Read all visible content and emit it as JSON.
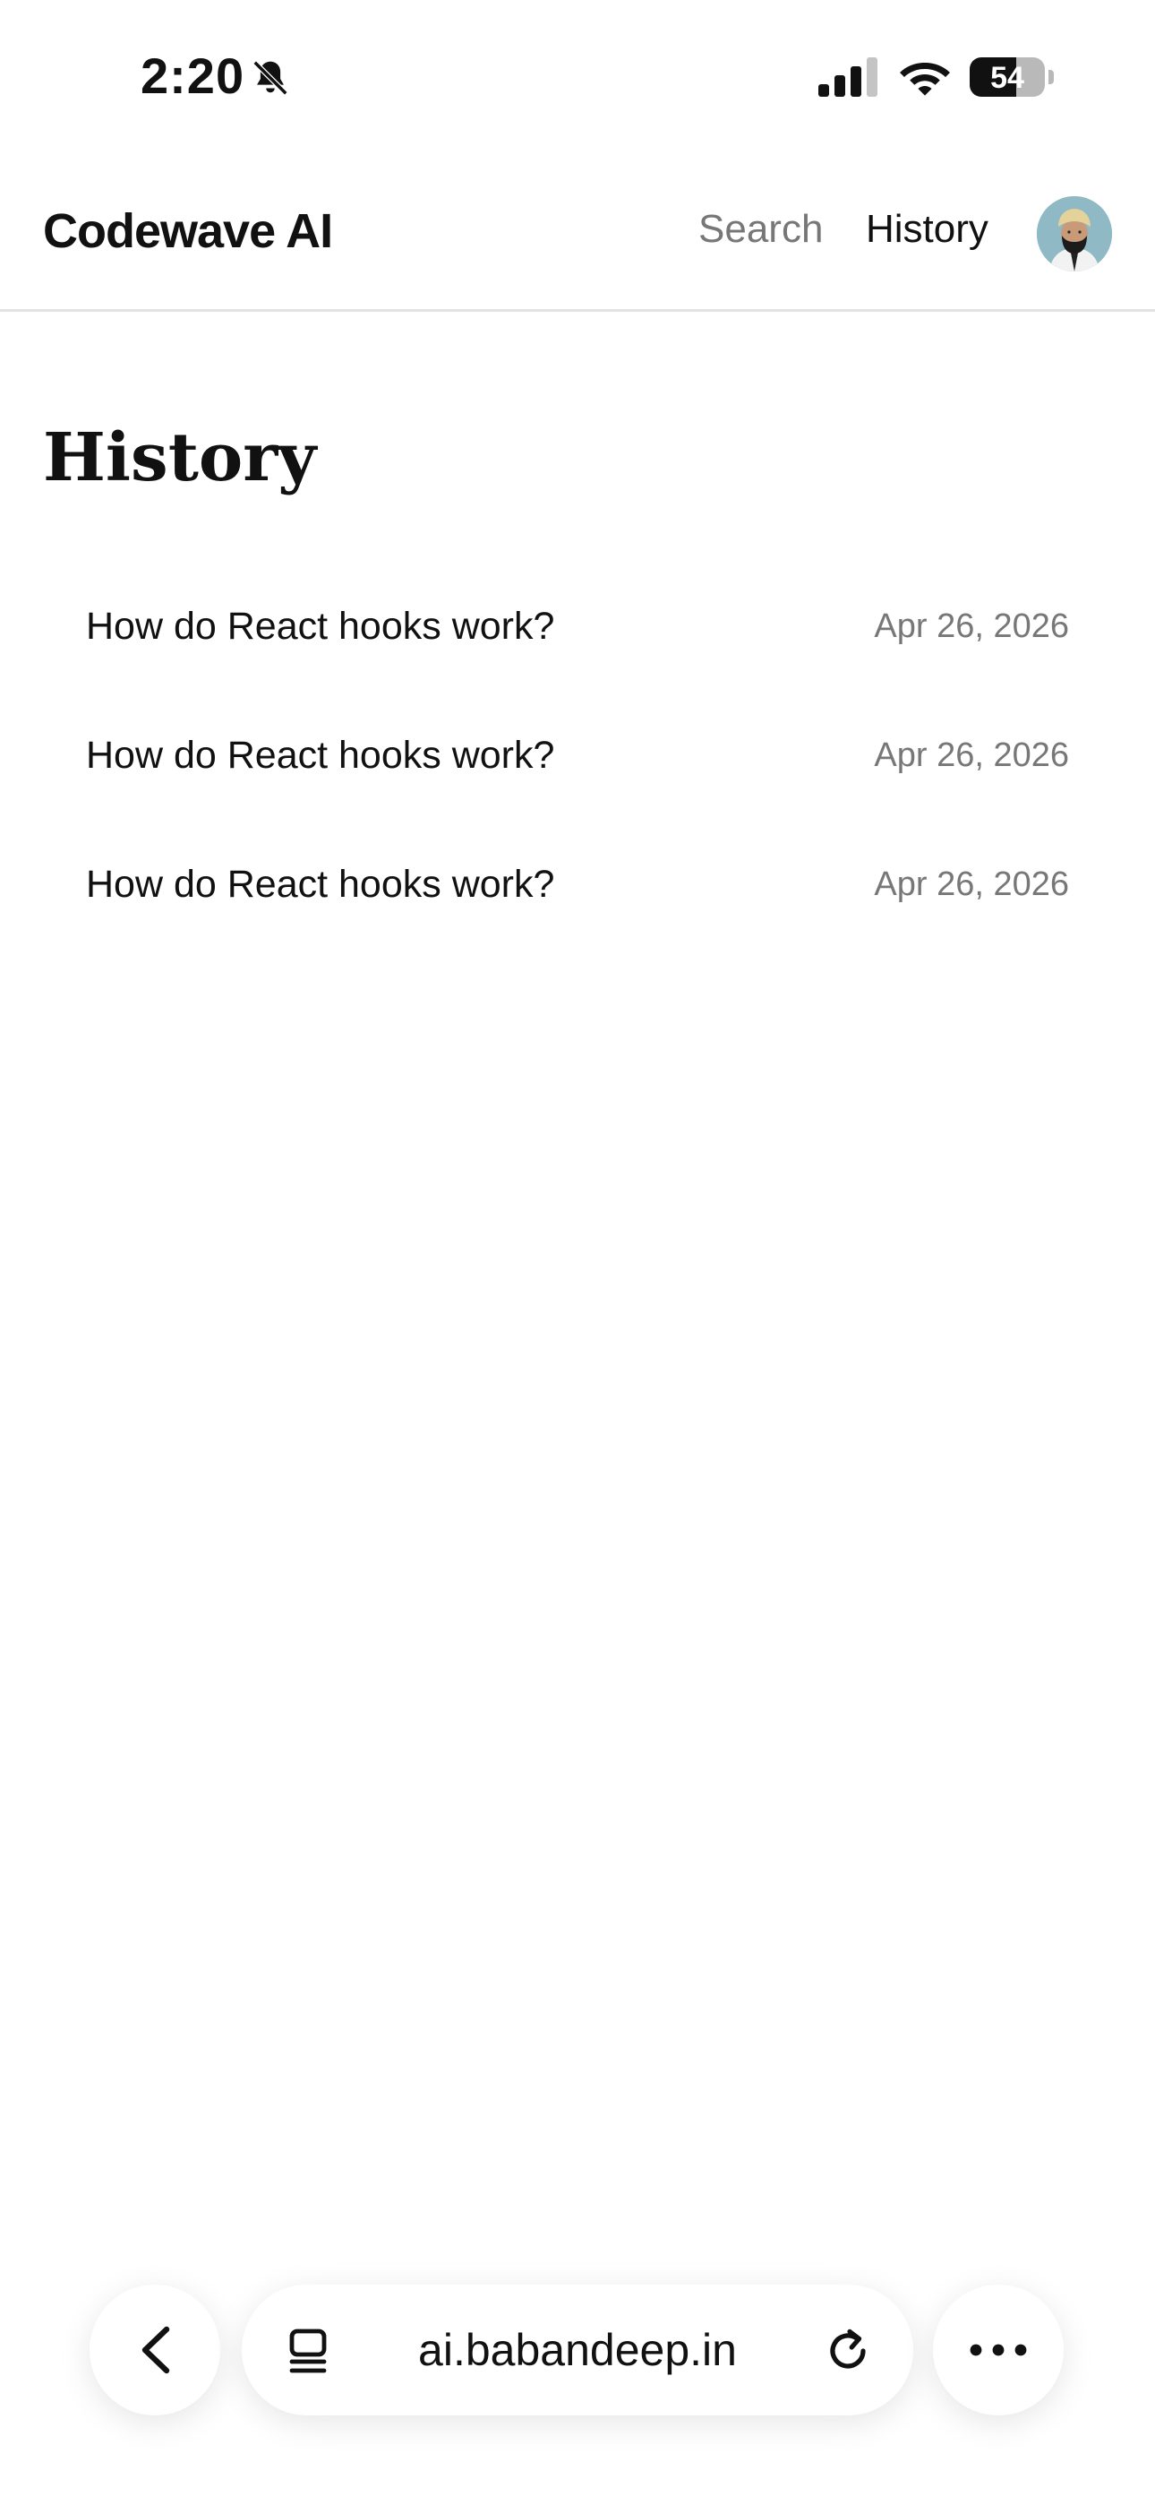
{
  "status_bar": {
    "time": "2:20",
    "battery": "54",
    "icons": [
      "bell-slash-icon",
      "cellular-signal-icon",
      "wifi-icon",
      "battery-icon"
    ]
  },
  "header": {
    "brand": "Codewave AI",
    "nav": {
      "search": "Search",
      "history": "History"
    },
    "active_nav": "History",
    "avatar_icon": "user-avatar"
  },
  "main": {
    "title": "History",
    "items": [
      {
        "title": "How do React hooks work?",
        "date": "Apr 26, 2026"
      },
      {
        "title": "How do React hooks work?",
        "date": "Apr 26, 2026"
      },
      {
        "title": "How do React hooks work?",
        "date": "Apr 26, 2026"
      }
    ]
  },
  "browser_bar": {
    "url": "ai.babandeep.in",
    "icons": [
      "chevron-left-icon",
      "tabs-icon",
      "reload-icon",
      "more-icon"
    ]
  },
  "colors": {
    "text": "#111111",
    "muted": "#777777",
    "divider": "#e2e2e2",
    "background": "#ffffff"
  }
}
